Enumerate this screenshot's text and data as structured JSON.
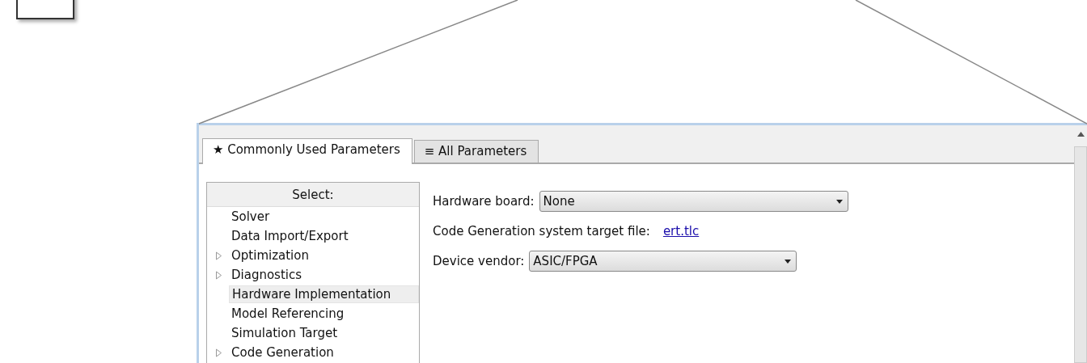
{
  "tabs": [
    {
      "icon": "★",
      "label": "Commonly Used Parameters",
      "selected": true
    },
    {
      "icon": "≡",
      "label": "All Parameters",
      "selected": false
    }
  ],
  "tree": {
    "header": "Select:",
    "items": [
      {
        "label": "Solver",
        "selected": false
      },
      {
        "label": "Data Import/Export",
        "selected": false
      },
      {
        "label": "Optimization",
        "selected": false,
        "expanded": false
      },
      {
        "label": "Diagnostics",
        "selected": false,
        "expanded": false
      },
      {
        "label": "Hardware Implementation",
        "selected": true
      },
      {
        "label": "Model Referencing",
        "selected": false
      },
      {
        "label": "Simulation Target",
        "selected": false
      },
      {
        "label": "Code Generation",
        "selected": false,
        "expanded": false
      }
    ]
  },
  "settings": [
    {
      "kind": "dropdown",
      "label": "Hardware board:",
      "value": "None"
    },
    {
      "kind": "link",
      "label": "Code Generation system target file:",
      "value": "ert.tlc"
    },
    {
      "kind": "dropdown",
      "label": "Device vendor:",
      "value": "ASIC/FPGA"
    }
  ]
}
